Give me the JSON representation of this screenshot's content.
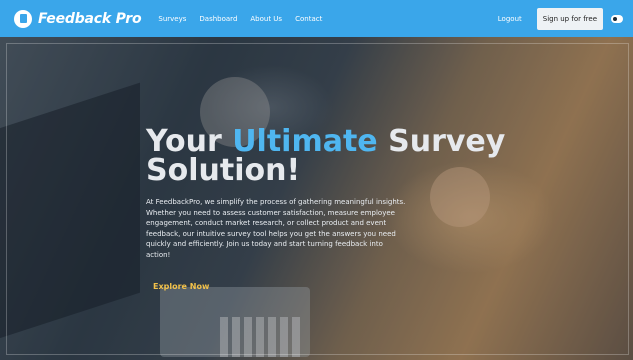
{
  "nav": {
    "brand": "Feedback Pro",
    "links": [
      "Surveys",
      "Dashboard",
      "About Us",
      "Contact"
    ],
    "logout": "Logout",
    "signup": "Sign up for free"
  },
  "hero": {
    "headline_part1": "Your ",
    "headline_accent": "Ultimate",
    "headline_part2": " Survey Solution!",
    "description": "At FeedbackPro, we simplify the process of gathering meaningful insights. Whether you need to assess customer satisfaction, measure employee engagement, conduct market research, or collect product and event feedback, our intuitive survey tool helps you get the answers you need quickly and efficiently. Join us today and start turning feedback into action!",
    "cta": "Explore Now"
  },
  "colors": {
    "nav_bg": "#3aa6ea",
    "accent": "#4fb6f0",
    "cta": "#f2c14a"
  }
}
